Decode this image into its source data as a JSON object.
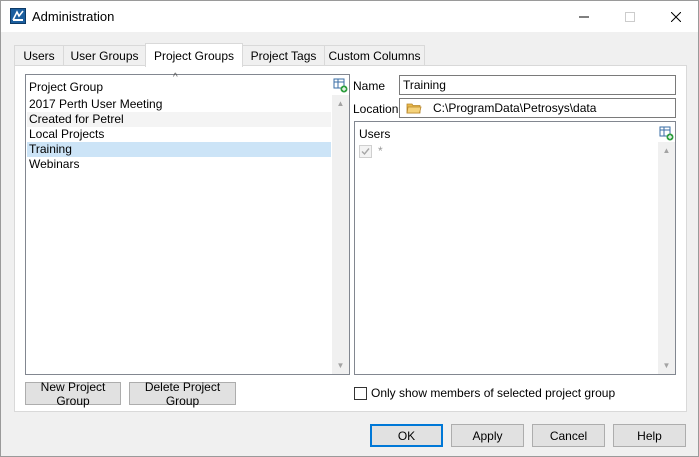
{
  "window": {
    "title": "Administration"
  },
  "tabs": [
    {
      "label": "Users"
    },
    {
      "label": "User Groups"
    },
    {
      "label": "Project Groups"
    },
    {
      "label": "Project Tags"
    },
    {
      "label": "Custom Columns"
    }
  ],
  "active_tab": "Project Groups",
  "project_list": {
    "header": "Project Group",
    "items": [
      {
        "label": "2017 Perth User Meeting"
      },
      {
        "label": "Created for Petrel"
      },
      {
        "label": "Local Projects"
      },
      {
        "label": "Training"
      },
      {
        "label": "Webinars"
      }
    ],
    "selected": "Training"
  },
  "details": {
    "name_label": "Name",
    "name_value": "Training",
    "location_label": "Location",
    "location_value": "C:\\ProgramData\\Petrosys\\data"
  },
  "users": {
    "header": "Users",
    "items": [
      {
        "label": "*",
        "checked": true
      }
    ]
  },
  "buttons": {
    "new_group": "New Project Group",
    "delete_group": "Delete Project Group",
    "ok": "OK",
    "apply": "Apply",
    "cancel": "Cancel",
    "help": "Help"
  },
  "filter_checkbox": {
    "label": "Only show members of selected project group",
    "checked": false
  },
  "colors": {
    "selection": "#cce4f7",
    "default_button_border": "#0078d7",
    "folder": "#e8b84a"
  }
}
